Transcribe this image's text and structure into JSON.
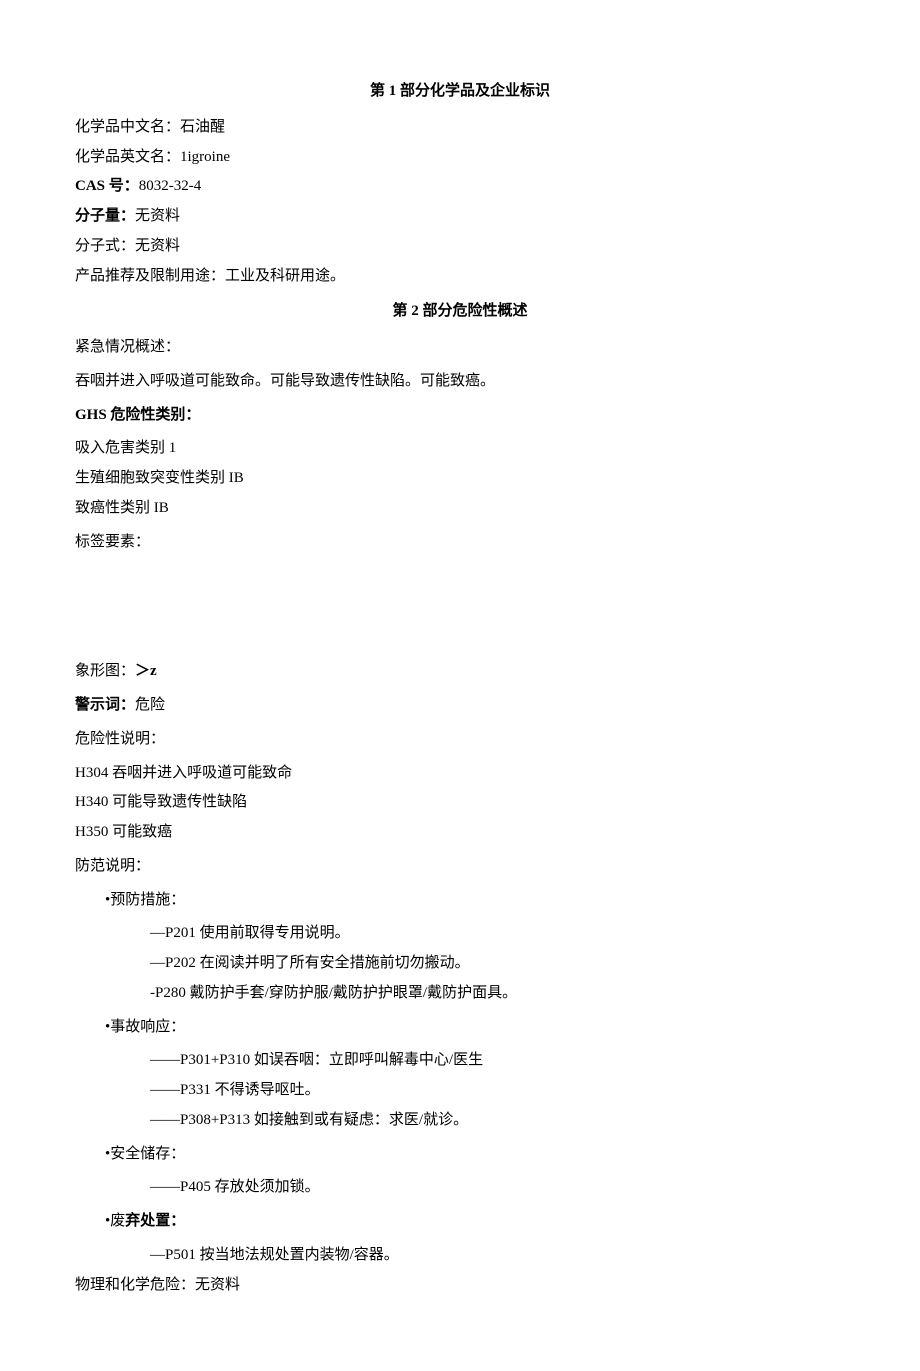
{
  "section1": {
    "header": "第 1 部分化学品及企业标识",
    "name_cn_label": "化学品中文名：",
    "name_cn": "石油醒",
    "name_en_label": "化学品英文名：",
    "name_en": "1igroine",
    "cas_label": "CAS 号：",
    "cas": "8032-32-4",
    "mw_label": "分子量：",
    "mw": "无资料",
    "formula_label": "分子式：",
    "formula": "无资料",
    "uses_label": "产品推荐及限制用途：",
    "uses": "工业及科研用途。"
  },
  "section2": {
    "header": "第 2 部分危险性概述",
    "emergency_label": "紧急情况概述：",
    "emergency_text": "吞咽并进入呼吸道可能致命。可能导致遗传性缺陷。可能致癌。",
    "ghs_label": "GHS 危险性类别：",
    "ghs_items": [
      "吸入危害类别 1",
      "生殖细胞致突变性类别 IB",
      "致癌性类别 IB"
    ],
    "label_elements": "标签要素：",
    "pictogram_label": "象形图：",
    "pictogram_value": "＞z",
    "signal_label": "警示词：",
    "signal_value": "危险",
    "hazard_label": "危险性说明：",
    "hazard_items": [
      "H304 吞咽并进入呼吸道可能致命",
      "H340 可能导致遗传性缺陷",
      "H350 可能致癌"
    ],
    "prevention_label": "防范说明：",
    "prevention": {
      "header": "•预防措施：",
      "items": [
        "—P201 使用前取得专用说明。",
        "—P202 在阅读并明了所有安全措施前切勿搬动。",
        "-P280 戴防护手套/穿防护服/戴防护护眼罩/戴防护面具。"
      ]
    },
    "response": {
      "header": "•事故响应：",
      "items": [
        "——P301+P310 如误吞咽：立即呼叫解毒中心/医生",
        "——P331 不得诱导呕吐。",
        "——P308+P313 如接触到或有疑虑：求医/就诊。"
      ]
    },
    "storage": {
      "header": "•安全储存：",
      "items": [
        "——P405 存放处须加锁。"
      ]
    },
    "disposal": {
      "header_prefix": "•废",
      "header_bold": "弃处置：",
      "items": [
        "—P501 按当地法规处置内装物/容器。"
      ]
    },
    "phys_chem_label": "物理和化学危险：",
    "phys_chem_value": "无资料"
  }
}
